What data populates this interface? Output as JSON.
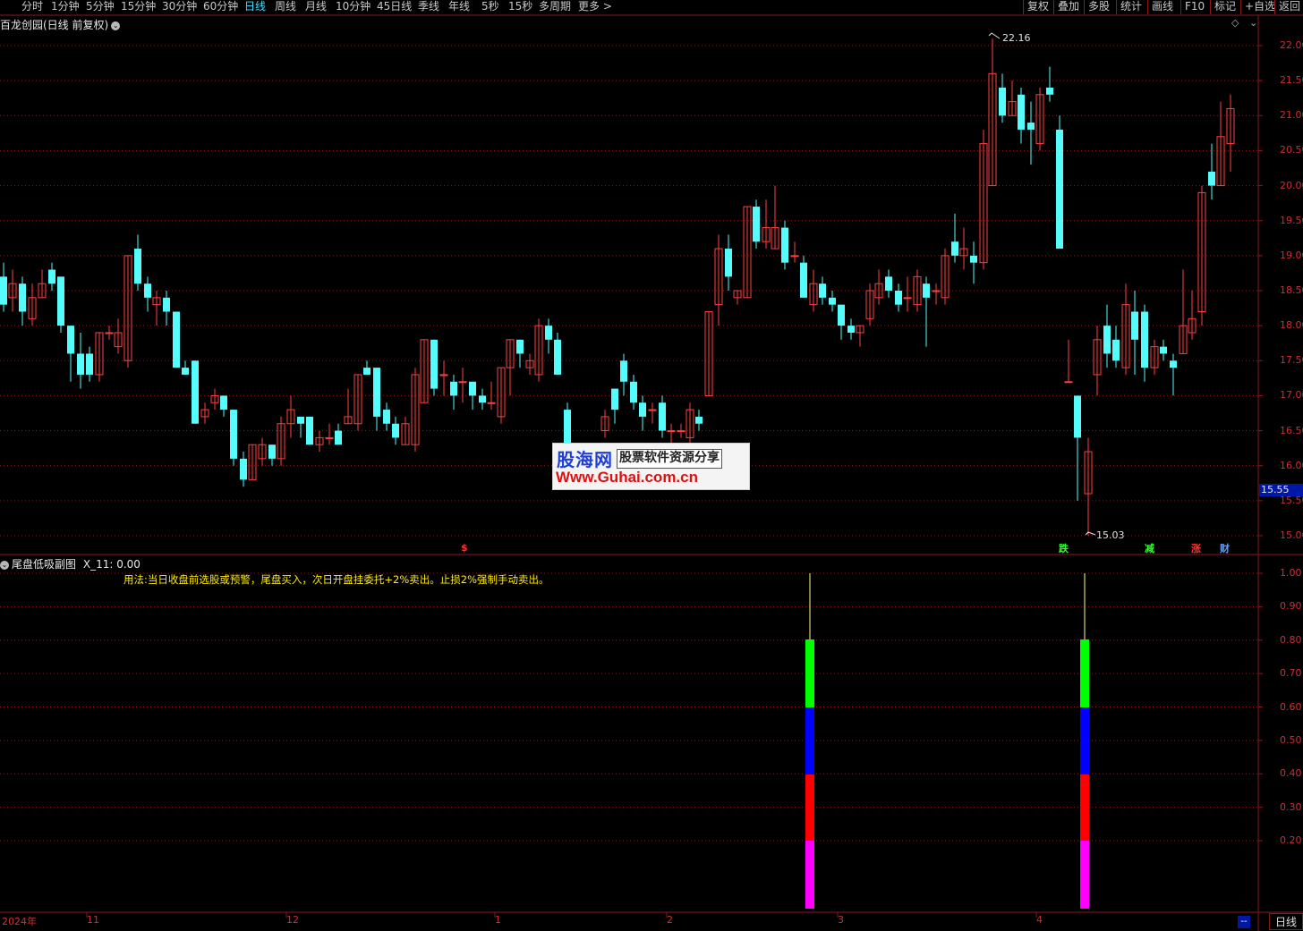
{
  "toolbar": {
    "periods": [
      "分时",
      "1分钟",
      "5分钟",
      "15分钟",
      "30分钟",
      "60分钟",
      "日线",
      "周线",
      "月线",
      "10分钟",
      "45日线",
      "季线",
      "年线",
      "5秒",
      "15秒",
      "多周期",
      "更多 >"
    ],
    "active_period": "日线",
    "right_buttons": [
      "复权",
      "叠加",
      "多股",
      "统计",
      "画线",
      "F10",
      "标记",
      "+自选",
      "返回"
    ]
  },
  "main_chart": {
    "title": "百龙创园(日线 前复权)",
    "y_axis_labels": [
      "22.00",
      "21.50",
      "21.00",
      "20.50",
      "20.00",
      "19.50",
      "19.00",
      "18.50",
      "18.00",
      "17.50",
      "17.00",
      "16.50",
      "16.00",
      "15.50",
      "15.00"
    ],
    "current_price": "15.55",
    "high_label": "22.16",
    "low_label": "15.03",
    "bottom_markers": [
      {
        "text": "$",
        "color": "#ff3030"
      },
      {
        "text": "跌",
        "color": "#30ff30"
      },
      {
        "text": "减",
        "color": "#30ff30"
      },
      {
        "text": "涨",
        "color": "#ff3030"
      },
      {
        "text": "财",
        "color": "#60a0ff"
      }
    ]
  },
  "sub_chart": {
    "title": "尾盘低吸副图",
    "indicator_value": "X_11: 0.00",
    "usage_text": "用法:当日收盘前选股或预警，尾盘买入，次日开盘挂委托+2%卖出。止损2%强制手动卖出。",
    "y_axis_labels": [
      "1.00",
      "0.90",
      "0.80",
      "0.70",
      "0.60",
      "0.50",
      "0.40",
      "0.30",
      "0.20"
    ],
    "signals": [
      {
        "segments_colors": [
          "#ff00ff",
          "#ff0000",
          "#0000ff",
          "#00ff00"
        ],
        "value": 1.0
      },
      {
        "segments_colors": [
          "#ff00ff",
          "#ff0000",
          "#0000ff",
          "#00ff00"
        ],
        "value": 1.0
      }
    ]
  },
  "time_axis": {
    "labels": [
      "2024年",
      "11",
      "12",
      "1",
      "2",
      "3",
      "4"
    ],
    "dash_button": "--",
    "period_button": "日线"
  },
  "watermark": {
    "logo": "股海网",
    "tagline": "股票软件资源分享",
    "url": "Www.Guhai.com.cn"
  },
  "colors": {
    "up": "#ff4040",
    "down": "#54fcfc",
    "grid": "#8a1a1a",
    "axis_text": "#cc3030"
  }
}
